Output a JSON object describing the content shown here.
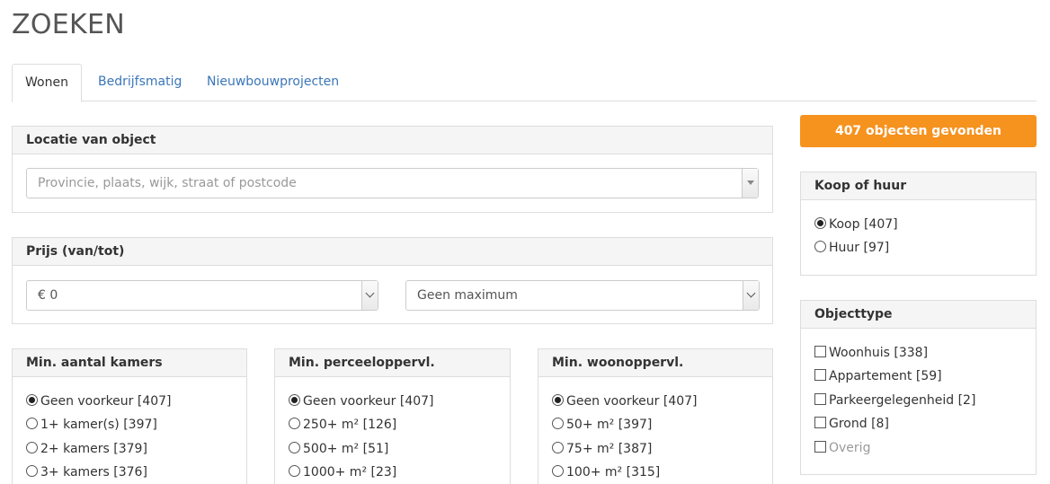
{
  "page": {
    "title": "ZOEKEN"
  },
  "tabs": [
    {
      "label": "Wonen",
      "active": true
    },
    {
      "label": "Bedrijfsmatig",
      "active": false
    },
    {
      "label": "Nieuwbouwprojecten",
      "active": false
    }
  ],
  "location": {
    "heading": "Locatie van object",
    "placeholder": "Provincie, plaats, wijk, straat of postcode"
  },
  "price": {
    "heading": "Prijs (van/tot)",
    "min_value": "€ 0",
    "max_value": "Geen maximum"
  },
  "rooms": {
    "heading": "Min. aantal kamers",
    "options": [
      {
        "label": "Geen voorkeur [407]",
        "selected": true
      },
      {
        "label": "1+ kamer(s) [397]",
        "selected": false
      },
      {
        "label": "2+ kamers [379]",
        "selected": false
      },
      {
        "label": "3+ kamers [376]",
        "selected": false
      }
    ]
  },
  "plot": {
    "heading": "Min. perceeloppervl.",
    "options": [
      {
        "label": "Geen voorkeur [407]",
        "selected": true
      },
      {
        "label": "250+ m² [126]",
        "selected": false
      },
      {
        "label": "500+ m² [51]",
        "selected": false
      },
      {
        "label": "1000+ m² [23]",
        "selected": false
      }
    ]
  },
  "living": {
    "heading": "Min. woonoppervl.",
    "options": [
      {
        "label": "Geen voorkeur [407]",
        "selected": true
      },
      {
        "label": "50+ m² [397]",
        "selected": false
      },
      {
        "label": "75+ m² [387]",
        "selected": false
      },
      {
        "label": "100+ m² [315]",
        "selected": false
      }
    ]
  },
  "results": {
    "label": "407 objecten gevonden",
    "color": "#f6921e"
  },
  "buy_rent": {
    "heading": "Koop of huur",
    "options": [
      {
        "label": "Koop [407]",
        "selected": true
      },
      {
        "label": "Huur [97]",
        "selected": false
      }
    ]
  },
  "object_type": {
    "heading": "Objecttype",
    "options": [
      {
        "label": "Woonhuis [338]",
        "checked": false,
        "muted": false
      },
      {
        "label": "Appartement [59]",
        "checked": false,
        "muted": false
      },
      {
        "label": "Parkeergelegenheid [2]",
        "checked": false,
        "muted": false
      },
      {
        "label": "Grond [8]",
        "checked": false,
        "muted": false
      },
      {
        "label": "Overig",
        "checked": false,
        "muted": true
      }
    ]
  }
}
